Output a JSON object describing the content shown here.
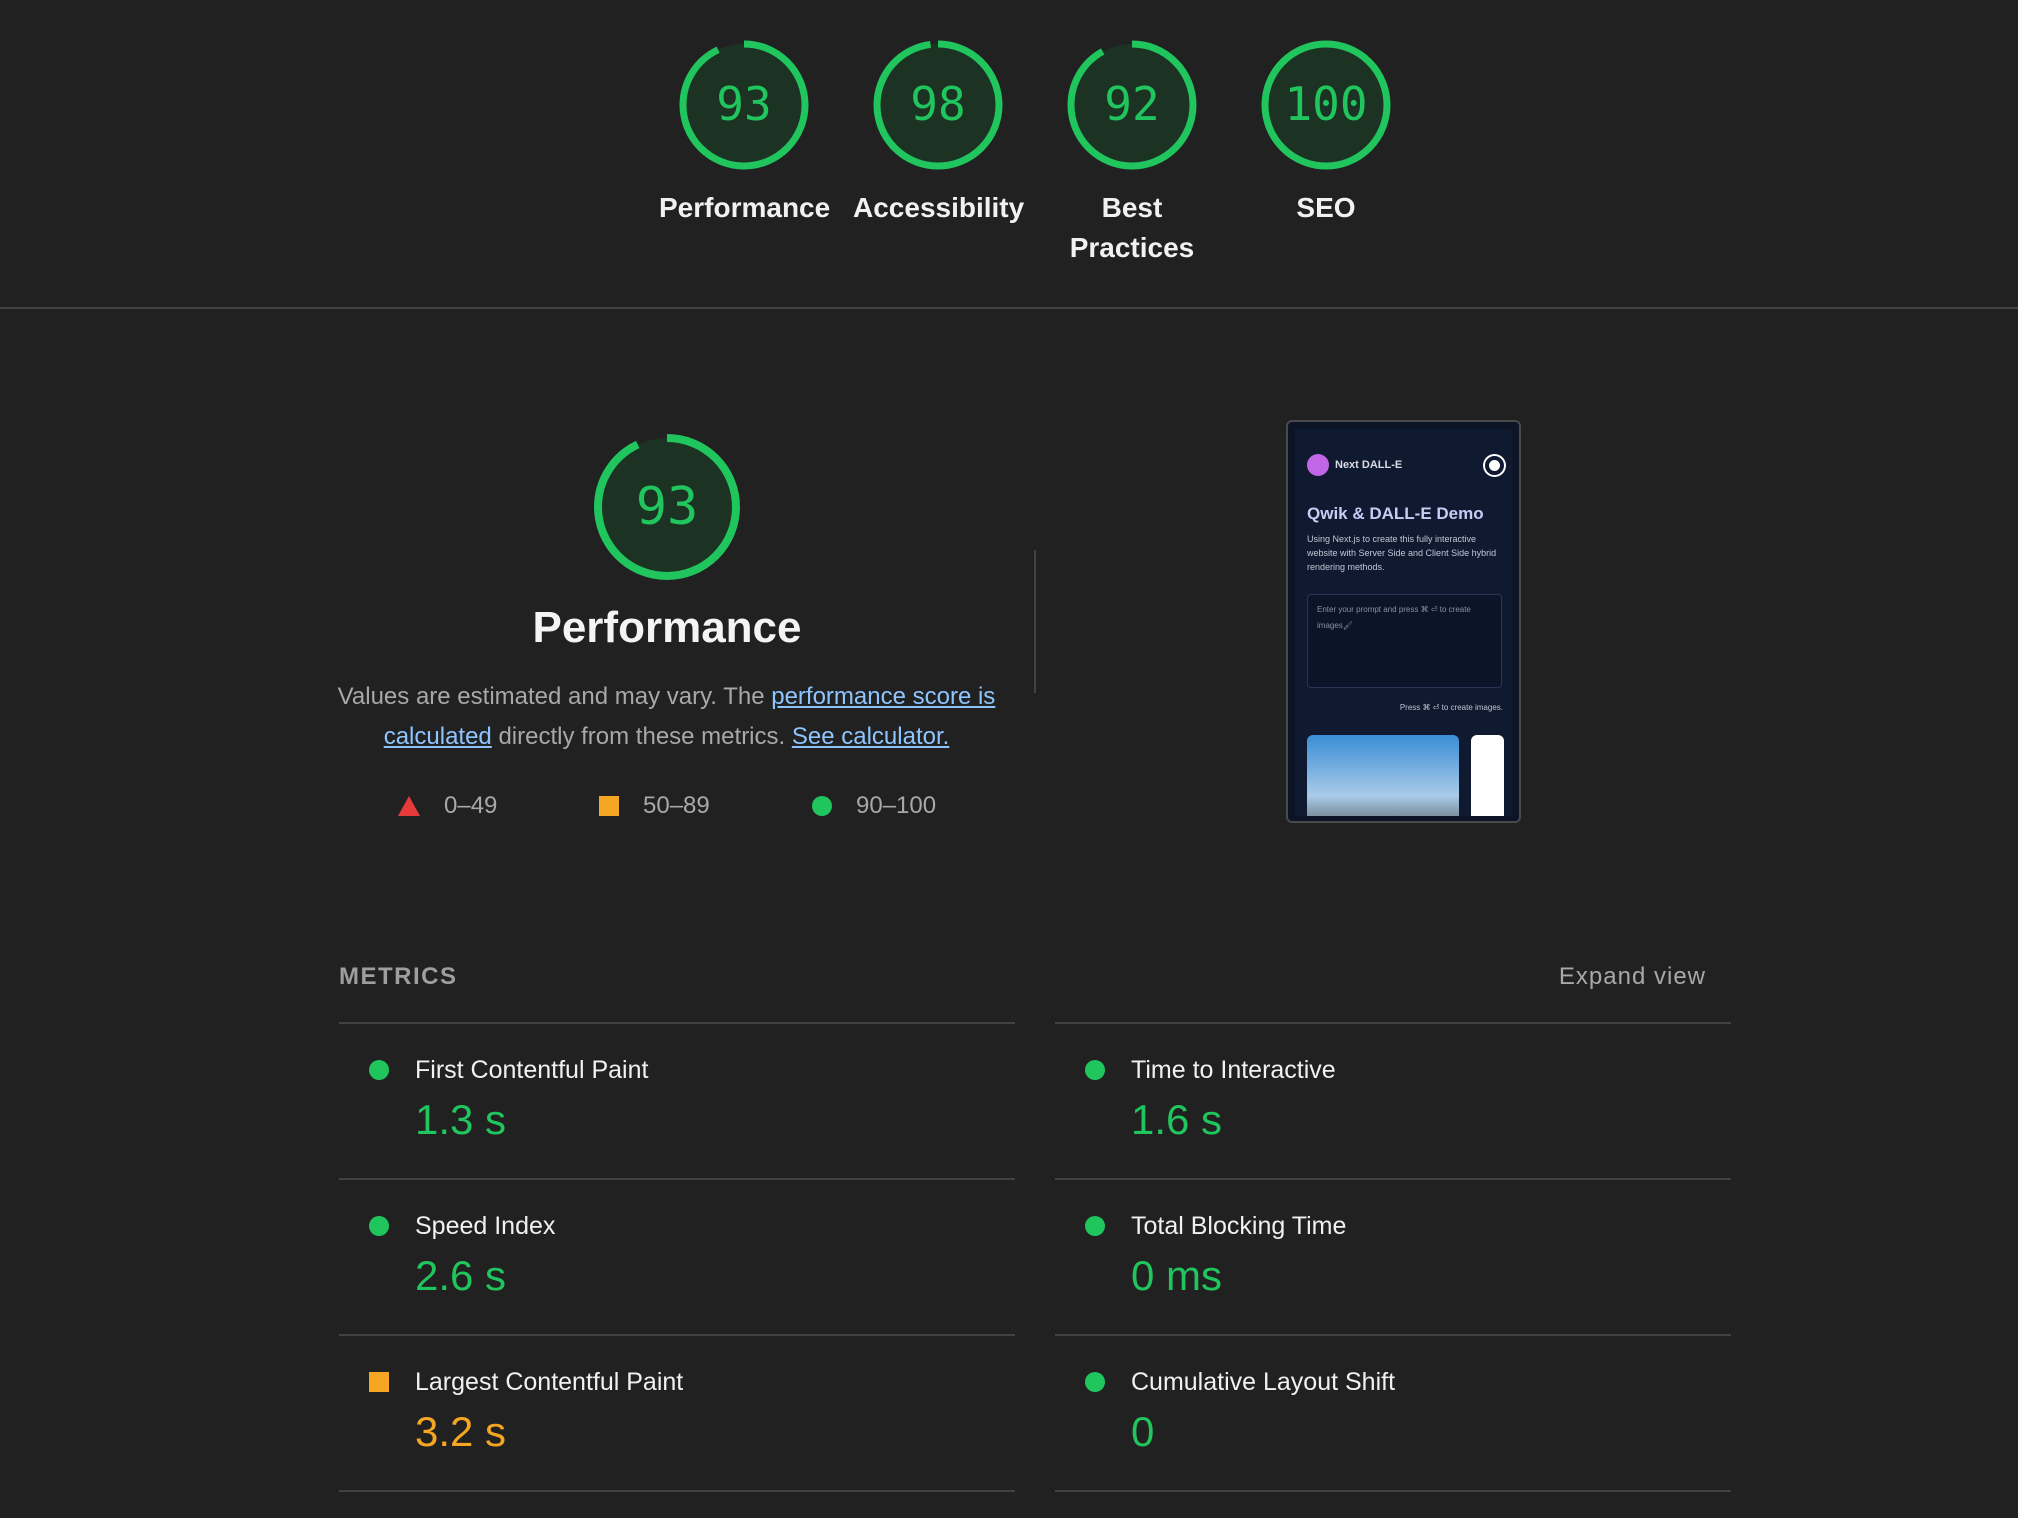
{
  "scores": [
    {
      "value": "93",
      "score": 0.93,
      "label": "Performance"
    },
    {
      "value": "98",
      "score": 0.98,
      "label": "Accessibility"
    },
    {
      "value": "92",
      "score": 0.92,
      "label": "Best Practices"
    },
    {
      "value": "100",
      "score": 1.0,
      "label": "SEO"
    }
  ],
  "performance": {
    "score": "93",
    "score_fraction": 0.93,
    "title": "Performance",
    "desc_prefix": "Values are estimated and may vary. The ",
    "link_score": "performance score is calculated",
    "desc_middle": " directly from these metrics. ",
    "link_calculator": "See calculator.",
    "legend": [
      {
        "range": "0–49",
        "shape": "triangle",
        "color": "#e73b3b"
      },
      {
        "range": "50–89",
        "shape": "square",
        "color": "#f5a623"
      },
      {
        "range": "90–100",
        "shape": "circle",
        "color": "#21c55e"
      }
    ]
  },
  "screenshot": {
    "brand": "Next DALL-E",
    "title": "Qwik & DALL-E Demo",
    "text": "Using Next.js to create this fully interactive website with Server Side and Client Side hybrid rendering methods.",
    "placeholder": "Enter your prompt and press ⌘ ⏎ to create images🖌",
    "hint": "Press ⌘ ⏎ to create images."
  },
  "metrics": {
    "heading": "METRICS",
    "expand_label": "Expand view",
    "items": [
      {
        "name": "First Contentful Paint",
        "value": "1.3 s",
        "rating": "good"
      },
      {
        "name": "Time to Interactive",
        "value": "1.6 s",
        "rating": "good"
      },
      {
        "name": "Speed Index",
        "value": "2.6 s",
        "rating": "good"
      },
      {
        "name": "Total Blocking Time",
        "value": "0 ms",
        "rating": "good"
      },
      {
        "name": "Largest Contentful Paint",
        "value": "3.2 s",
        "rating": "average"
      },
      {
        "name": "Cumulative Layout Shift",
        "value": "0",
        "rating": "good"
      }
    ]
  },
  "colors": {
    "good": "#21c55e",
    "average": "#f5a623",
    "poor": "#e73b3b",
    "background": "#212121"
  }
}
